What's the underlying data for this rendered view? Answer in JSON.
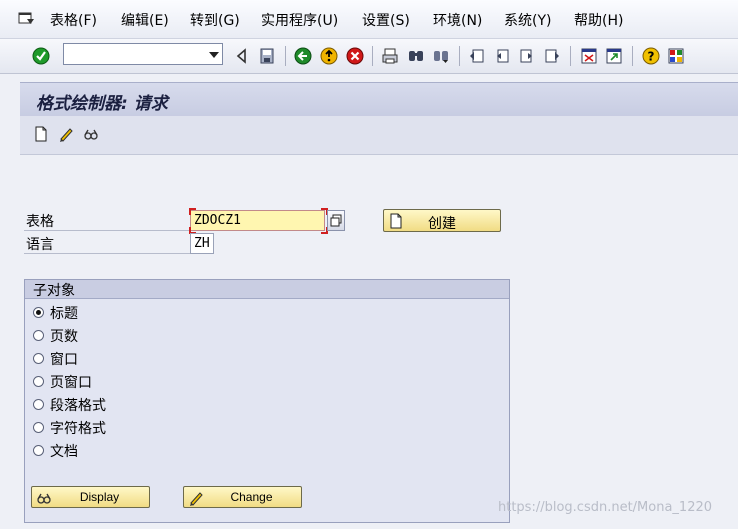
{
  "menu": {
    "items": [
      "表格(F)",
      "编辑(E)",
      "转到(G)",
      "实用程序(U)",
      "设置(S)",
      "环境(N)",
      "系统(Y)",
      "帮助(H)"
    ]
  },
  "toolbar": {
    "command_value": "",
    "icons": [
      "enter-icon",
      "back-icon",
      "save-icon",
      "back-green-icon",
      "exit-icon",
      "cancel-icon",
      "print-icon",
      "find-icon",
      "find-next-icon",
      "first-page-icon",
      "prev-page-icon",
      "next-page-icon",
      "last-page-icon",
      "new-session-icon",
      "shortcut-icon",
      "help-icon",
      "layout-icon"
    ]
  },
  "title": "格式绘制器: 请求",
  "app_toolbar": {
    "icons": [
      "create-icon",
      "change-icon",
      "display-icon"
    ]
  },
  "form": {
    "form_label": "表格",
    "form_value": "ZDOCZ1",
    "language_label": "语言",
    "language_value": "ZH",
    "create_button": "创建"
  },
  "subobjects": {
    "title": "子对象",
    "options": [
      {
        "label": "标题",
        "selected": true
      },
      {
        "label": "页数",
        "selected": false
      },
      {
        "label": "窗口",
        "selected": false
      },
      {
        "label": "页窗口",
        "selected": false
      },
      {
        "label": "段落格式",
        "selected": false
      },
      {
        "label": "字符格式",
        "selected": false
      },
      {
        "label": "文档",
        "selected": false
      }
    ],
    "display_button": "Display",
    "change_button": "Change"
  },
  "watermark": "https://blog.csdn.net/Mona_1220",
  "colors": {
    "button_fill": "#f1dc84",
    "required_field": "#fff6b0",
    "title_bar": "#c7cce2",
    "enter_green": "#1f9a2a",
    "exit_yellow": "#f0b400",
    "cancel_red": "#d01818"
  }
}
